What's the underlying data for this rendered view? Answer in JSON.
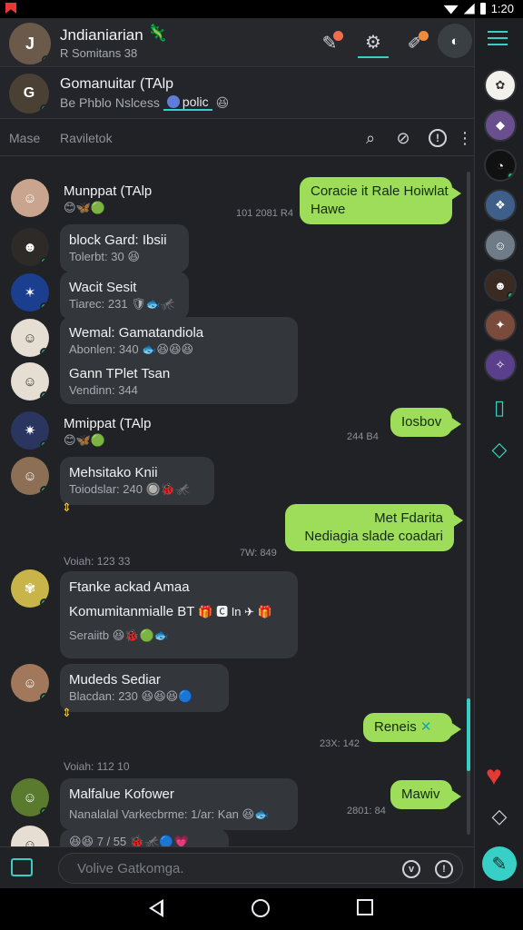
{
  "status": {
    "time": "1:20"
  },
  "header": {
    "name": "Jndianiarian",
    "name_emoji": "🦎",
    "sub": "R Somitans 38"
  },
  "group": {
    "name": "Gomanuitar (TAlp",
    "sub_prefix": "Be Phblo",
    "sub_mid": "Nslcess",
    "chip": "polic",
    "sub_emoji": "😆"
  },
  "search": {
    "tab1": "Mase",
    "tab2": "Raviletok"
  },
  "colors": {
    "accent": "#38d0c6",
    "outgoing": "#9ddd5a",
    "incoming": "#33363b",
    "background": "#202226"
  },
  "messages": {
    "m1": {
      "title": "Munppat (TAlp",
      "emoji": "😊🦋🟢"
    },
    "o1": {
      "text1": "Coracie it Rale Hoiwlat",
      "text2": "Hawe",
      "time": "101 2081 R4"
    },
    "m2": {
      "title": "block Gard: Ibsii",
      "sub": "Tolerbt: 30",
      "emoji": "😆"
    },
    "m3": {
      "title": "Wacit Sesit",
      "sub": "Tiarec: 231",
      "emoji": "🛡🐟🦟"
    },
    "m4": {
      "title": "Wemal: Gamatandiola",
      "sub": "Abonlen: 340",
      "emoji": "🐟😆😆😆"
    },
    "m5": {
      "title": "Gann TPlet Tsan",
      "sub": "Vendinn: 344"
    },
    "m6": {
      "title": "Mmippat (TAlp",
      "emoji": "😊🦋🟢"
    },
    "o2": {
      "text1": "Iosbov",
      "time": "244 B4"
    },
    "m7": {
      "title": "Mehsitako Knii",
      "sub": "Toiodslar: 240",
      "emoji": "🔘🐞🦟"
    },
    "o3": {
      "text1": "Met Fdarita",
      "text2": "Nediagia slade coadari",
      "time": "7W: 849"
    },
    "d1": {
      "text": "Voiah: 123 33"
    },
    "m8": {
      "title": "Ftanke ackad Amaa",
      "line2": "Komumitanmialle BT",
      "emoji2": "🎁 🅲 In ✈ 🎁",
      "sub": "Seraiitb",
      "emoji": "😆🐞🟢🐟"
    },
    "m9": {
      "title": "Mudeds Sediar",
      "sub": "Blacdan: 230",
      "emoji": "😆😆😆🔵"
    },
    "o4": {
      "text1": "Reneis",
      "icon": "✕",
      "time": "23X: 142"
    },
    "d2": {
      "text": "Voiah: 112 10"
    },
    "m10": {
      "title": "Malfalue Kofower",
      "sub": "Nanalalal Varkecbrme: 1/ar: Kan",
      "emoji": "😆🐟"
    },
    "o5": {
      "text1": "Mawiv",
      "time": "2801: 84"
    },
    "m11": {
      "sub": "7 / 55",
      "emoji_a": "😆😆",
      "emoji_b": "🐞🦟🔵💗"
    }
  },
  "composer": {
    "placeholder": "Volive Gatkomga."
  }
}
